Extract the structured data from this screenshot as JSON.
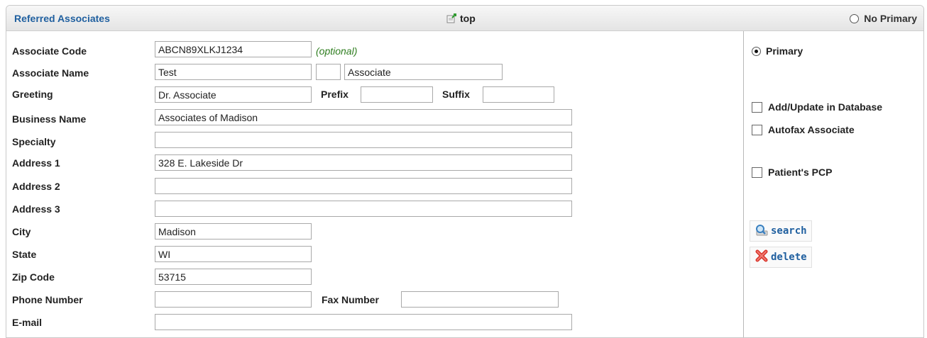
{
  "header": {
    "title": "Referred Associates",
    "top_label": "top",
    "no_primary_label": "No Primary"
  },
  "form": {
    "associate_code": {
      "label": "Associate Code",
      "value": "ABCN89XLKJ1234",
      "hint": "(optional)"
    },
    "associate_name": {
      "label": "Associate Name",
      "first": "Test",
      "middle": "",
      "last": "Associate"
    },
    "greeting": {
      "label": "Greeting",
      "value": "Dr. Associate"
    },
    "prefix": {
      "label": "Prefix",
      "value": ""
    },
    "suffix": {
      "label": "Suffix",
      "value": ""
    },
    "business_name": {
      "label": "Business Name",
      "value": "Associates of Madison"
    },
    "specialty": {
      "label": "Specialty",
      "value": ""
    },
    "address1": {
      "label": "Address 1",
      "value": "328 E. Lakeside Dr"
    },
    "address2": {
      "label": "Address 2",
      "value": ""
    },
    "address3": {
      "label": "Address 3",
      "value": ""
    },
    "city": {
      "label": "City",
      "value": "Madison"
    },
    "state": {
      "label": "State",
      "value": "WI"
    },
    "zip": {
      "label": "Zip Code",
      "value": "53715"
    },
    "phone": {
      "label": "Phone Number",
      "value": ""
    },
    "fax": {
      "label": "Fax Number",
      "value": ""
    },
    "email": {
      "label": "E-mail",
      "value": ""
    }
  },
  "side": {
    "primary_label": "Primary",
    "add_update_label": "Add/Update in Database",
    "autofax_label": "Autofax Associate",
    "pcp_label": "Patient's PCP",
    "search_label": "search",
    "delete_label": "delete"
  },
  "icons": {
    "top": "page-up-arrow-icon",
    "search": "magnifier-icon",
    "delete": "red-x-icon"
  },
  "colors": {
    "title_blue": "#1f5f9f",
    "hint_green": "#2e7d1f",
    "delete_red": "#d9342b"
  }
}
